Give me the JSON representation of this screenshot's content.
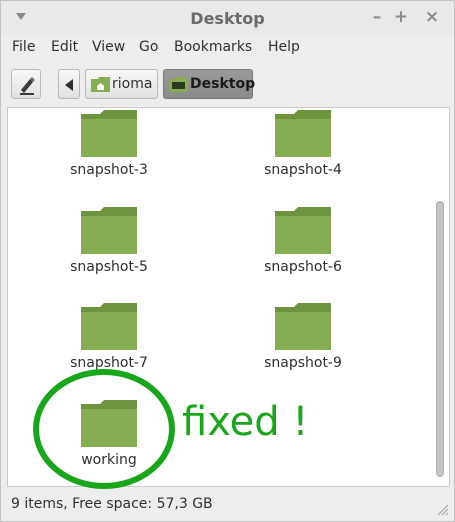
{
  "window": {
    "title": "Desktop"
  },
  "menubar": {
    "items": [
      "File",
      "Edit",
      "View",
      "Go",
      "Bookmarks",
      "Help"
    ]
  },
  "toolbar": {
    "breadcrumbs": [
      {
        "label": "rioma",
        "icon": "home-folder-icon"
      },
      {
        "label": "Desktop",
        "icon": "desktop-folder-icon"
      }
    ]
  },
  "files": [
    {
      "name": "snapshot-3"
    },
    {
      "name": "snapshot-4"
    },
    {
      "name": "snapshot-5"
    },
    {
      "name": "snapshot-6"
    },
    {
      "name": "snapshot-7"
    },
    {
      "name": "snapshot-9"
    },
    {
      "name": "working"
    }
  ],
  "annotation": {
    "text": "fixed !",
    "color": "#1aa61a"
  },
  "status": {
    "text": "9 items, Free space: 57,3 GB"
  },
  "colors": {
    "folder": "#86ad52",
    "folder_dark": "#6e9440"
  }
}
